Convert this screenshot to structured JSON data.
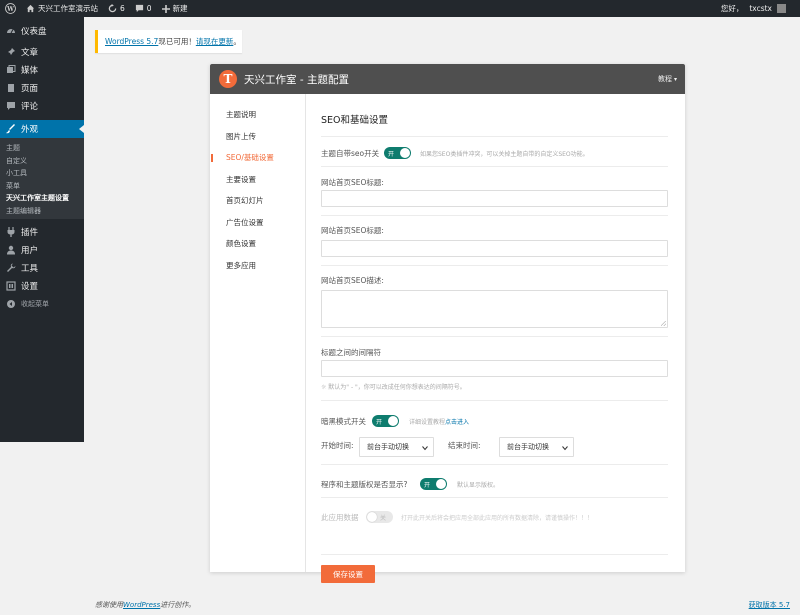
{
  "adminbar": {
    "site_name": "天兴工作室演示站",
    "updates_count": "6",
    "comments_count": "0",
    "new_label": "新建",
    "greeting": "您好，",
    "username": "txcstx"
  },
  "sidebar": {
    "items": [
      {
        "label": "仪表盘",
        "icon": "dashboard-icon"
      },
      {
        "label": "文章",
        "icon": "pin-icon"
      },
      {
        "label": "媒体",
        "icon": "media-icon"
      },
      {
        "label": "页面",
        "icon": "page-icon"
      },
      {
        "label": "评论",
        "icon": "comment-icon"
      },
      {
        "label": "外观",
        "icon": "brush-icon"
      },
      {
        "label": "插件",
        "icon": "plugin-icon"
      },
      {
        "label": "用户",
        "icon": "user-icon"
      },
      {
        "label": "工具",
        "icon": "wrench-icon"
      },
      {
        "label": "设置",
        "icon": "settings-icon"
      },
      {
        "label": "收起菜单",
        "icon": "collapse-icon"
      }
    ],
    "submenu": [
      "主题",
      "自定义",
      "小工具",
      "菜单",
      "天兴工作室主题设置",
      "主题编辑器"
    ]
  },
  "notice": {
    "version_link": "WordPress 5.7",
    "text": "现已可用！",
    "update_link": "请现在更新",
    "end": "。"
  },
  "panel": {
    "title": "天兴工作室 - 主题配置",
    "help": "教程"
  },
  "nav": [
    "主题说明",
    "图片上传",
    "SEO/基础设置",
    "主要设置",
    "首页幻灯片",
    "广告位设置",
    "颜色设置",
    "更多应用"
  ],
  "main": {
    "section_title": "SEO和基础设置",
    "seo_switch_label": "主题自带seo开关",
    "seo_switch_state": "开",
    "seo_switch_hint": "如果您SEO类插件冲突，可以关掉主题自带的自定义SEO功能。",
    "home_title_label": "网站首页SEO标题:",
    "home_keywords_label": "网站首页SEO标题:",
    "home_desc_label": "网站首页SEO描述:",
    "separator_label": "标题之间的间隔符",
    "separator_hint": "默认为\" - \"，你可以改成任何你想表达的间隔符号。",
    "dark_mode_label": "暗黑模式开关",
    "dark_mode_state": "开",
    "dark_mode_hint": "详细设置教程",
    "dark_mode_hint_link": "点击进入",
    "start_time_label": "开始时间:",
    "start_time_value": "前台手动切换",
    "end_time_label": "结束时间:",
    "end_time_value": "前台手动切换",
    "copyright_label": "程序和主题版权是否显示?",
    "copyright_state": "开",
    "copyright_hint": "默认显示版权。",
    "app_data_label": "此应用数据",
    "app_data_state": "关",
    "app_data_hint": "打开此开关后将会把应用全部此应用的所有数据清除，请谨慎操作！！！",
    "save_label": "保存设置"
  },
  "footer": {
    "thanks_prefix": "感谢使用",
    "wordpress_link": "WordPress",
    "thanks_suffix": "进行创作。",
    "version_link": "获取版本 5.7"
  },
  "colors": {
    "accent": "#f26b3a",
    "toggle_on": "#0e7c6e",
    "admin_dark": "#23282d",
    "wp_blue": "#0073aa",
    "notice_warning": "#ffb900"
  }
}
